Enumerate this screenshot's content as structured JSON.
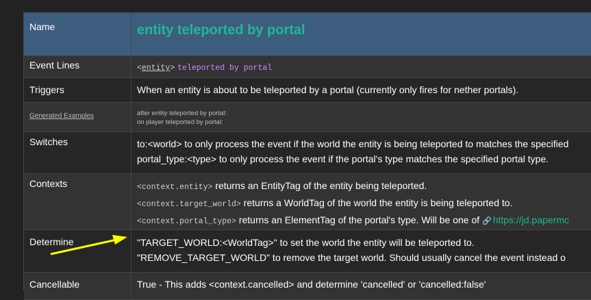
{
  "rows": {
    "name": {
      "key": "Name",
      "value": "entity teleported by portal"
    },
    "event_lines": {
      "key": "Event Lines",
      "entity": "entity",
      "rest": "teleported by portal"
    },
    "triggers": {
      "key": "Triggers",
      "value": "When an entity is about to be teleported by a portal (currently only fires for nether portals)."
    },
    "generated": {
      "key": "Generated Examples",
      "lines": [
        "after entity teleported by portal:",
        "on player teleported by portal:"
      ]
    },
    "switches": {
      "key": "Switches",
      "lines": [
        "to:<world> to only process the event if the world the entity is being teleported to matches the specified",
        "portal_type:<type> to only process the event if the portal's type matches the specified portal type."
      ]
    },
    "contexts": {
      "key": "Contexts",
      "items": [
        {
          "tag": "<context.entity>",
          "desc": "returns an EntityTag of the entity being teleported."
        },
        {
          "tag": "<context.target_world>",
          "desc": "returns a WorldTag of the world the entity is being teleported to."
        },
        {
          "tag": "<context.portal_type>",
          "desc": "returns an ElementTag of the portal's type. Will be one of",
          "link": "https://jd.papermc"
        }
      ]
    },
    "determine": {
      "key": "Determine",
      "lines": [
        "\"TARGET_WORLD:<WorldTag>\" to set the world the entity will be teleported to.",
        "\"REMOVE_TARGET_WORLD\" to remove the target world. Should usually cancel the event instead o"
      ]
    },
    "cancellable": {
      "key": "Cancellable",
      "value": "True - This adds <context.cancelled> and determine 'cancelled' or 'cancelled:false'"
    }
  },
  "annotation": {
    "arrow_color": "#ffff00"
  },
  "colors": {
    "header_bg": "#3d5d7e",
    "title": "#1fb995",
    "alt_row": "#333333",
    "row": "#262626",
    "tag": "#c78cff"
  }
}
